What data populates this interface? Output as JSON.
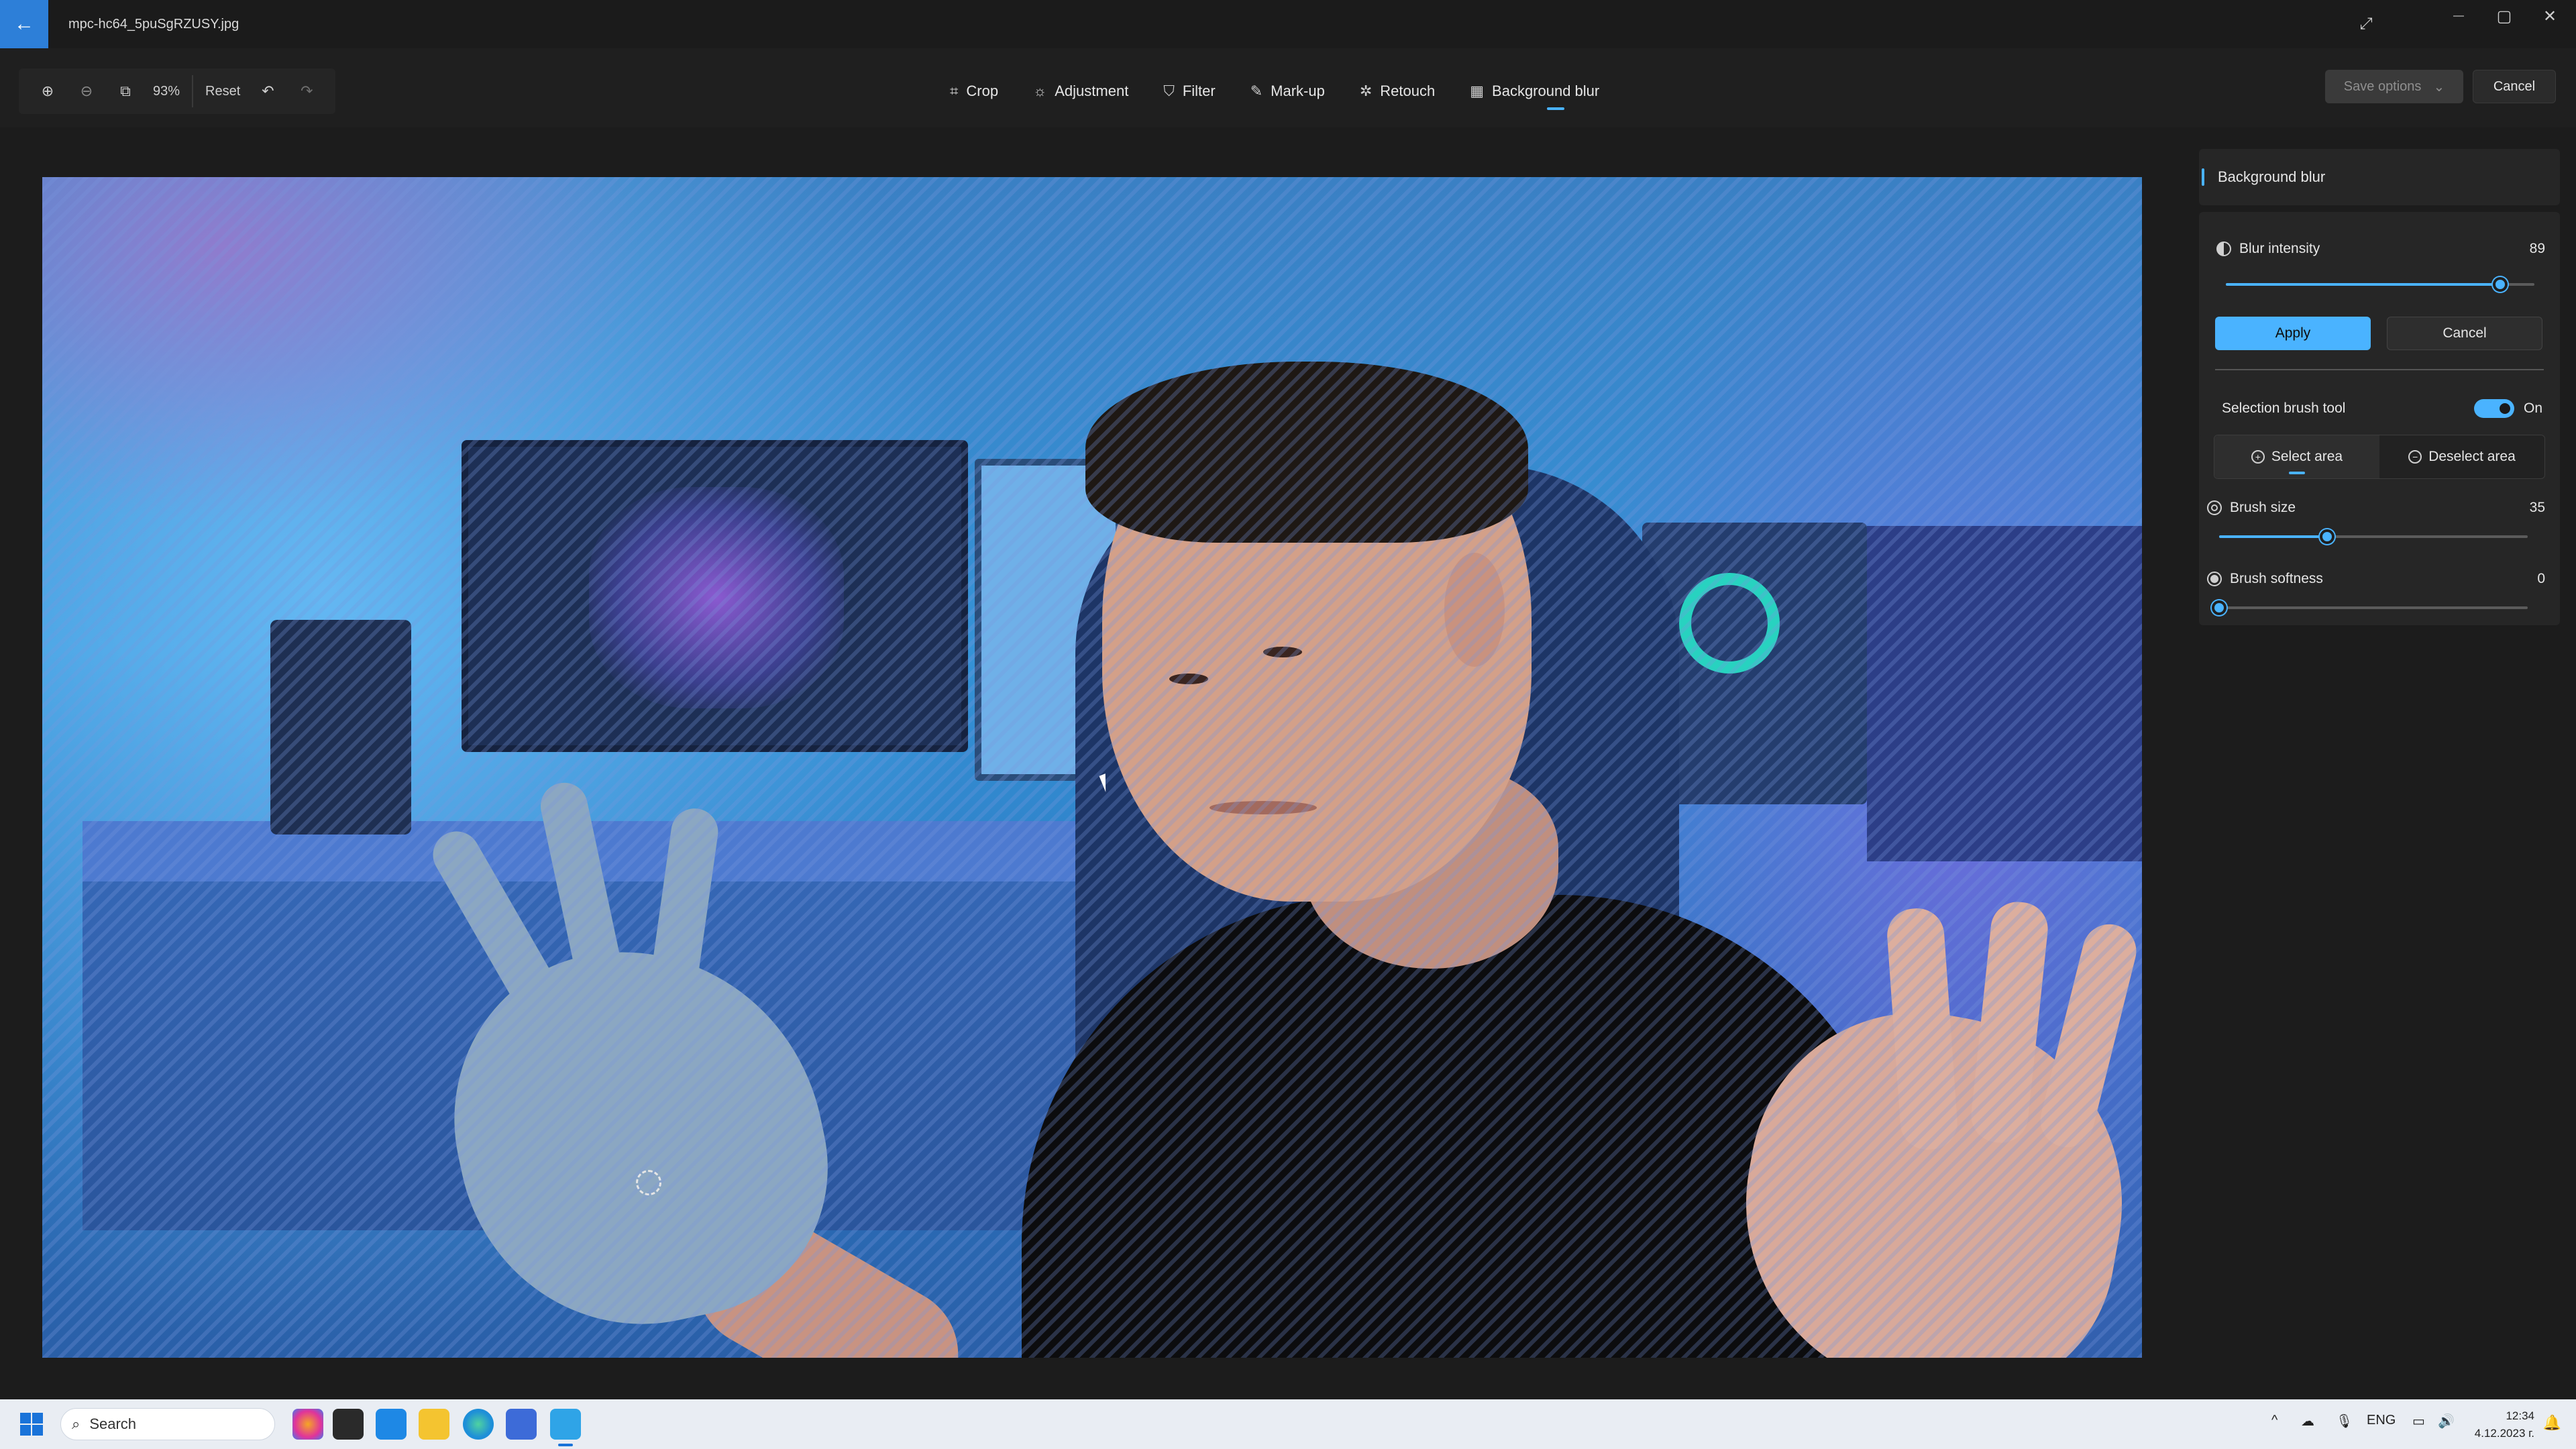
{
  "window": {
    "title": "mpc-hc64_5puSgRZUSY.jpg",
    "back_icon": "←",
    "expand_icon": "⤢",
    "minimize_icon": "—",
    "maximize_icon": "▢",
    "close_icon": "✕"
  },
  "toolbar": {
    "zoom_in_icon": "⊕",
    "zoom_out_icon": "⊖",
    "fit_icon": "⧉",
    "zoom_level": "93%",
    "reset_label": "Reset",
    "undo_icon": "↶",
    "redo_icon": "↷",
    "tools": [
      {
        "label": "Crop",
        "icon": "⌗"
      },
      {
        "label": "Adjustment",
        "icon": "☼"
      },
      {
        "label": "Filter",
        "icon": "⛉"
      },
      {
        "label": "Mark-up",
        "icon": "✎"
      },
      {
        "label": "Retouch",
        "icon": "✲"
      },
      {
        "label": "Background blur",
        "icon": "▦"
      }
    ],
    "active_tool": "Background blur",
    "save_options_label": "Save options",
    "save_chevron": "⌄",
    "cancel_label": "Cancel"
  },
  "panel": {
    "header": "Background blur",
    "blur_intensity_label": "Blur intensity",
    "blur_intensity_value": "89",
    "blur_intensity_fraction": 0.89,
    "apply_label": "Apply",
    "cancel_label": "Cancel",
    "selection_brush_label": "Selection brush tool",
    "selection_brush_state": "On",
    "select_area_label": "Select area",
    "deselect_area_label": "Deselect area",
    "select_icon": "+",
    "deselect_icon": "−",
    "brush_size_label": "Brush size",
    "brush_size_value": "35",
    "brush_size_fraction": 0.35,
    "brush_softness_label": "Brush softness",
    "brush_softness_value": "0",
    "brush_softness_fraction": 0.0
  },
  "taskbar": {
    "search_placeholder": "Search",
    "search_icon": "⌕",
    "language": "ENG",
    "time": "12:34",
    "date": "4.12.2023 г.",
    "up_icon": "^",
    "bell_icon": "🔔"
  },
  "colors": {
    "accent": "#4ab3ff",
    "back_button": "#2d7fd8",
    "taskbar": "#e9edf3"
  }
}
